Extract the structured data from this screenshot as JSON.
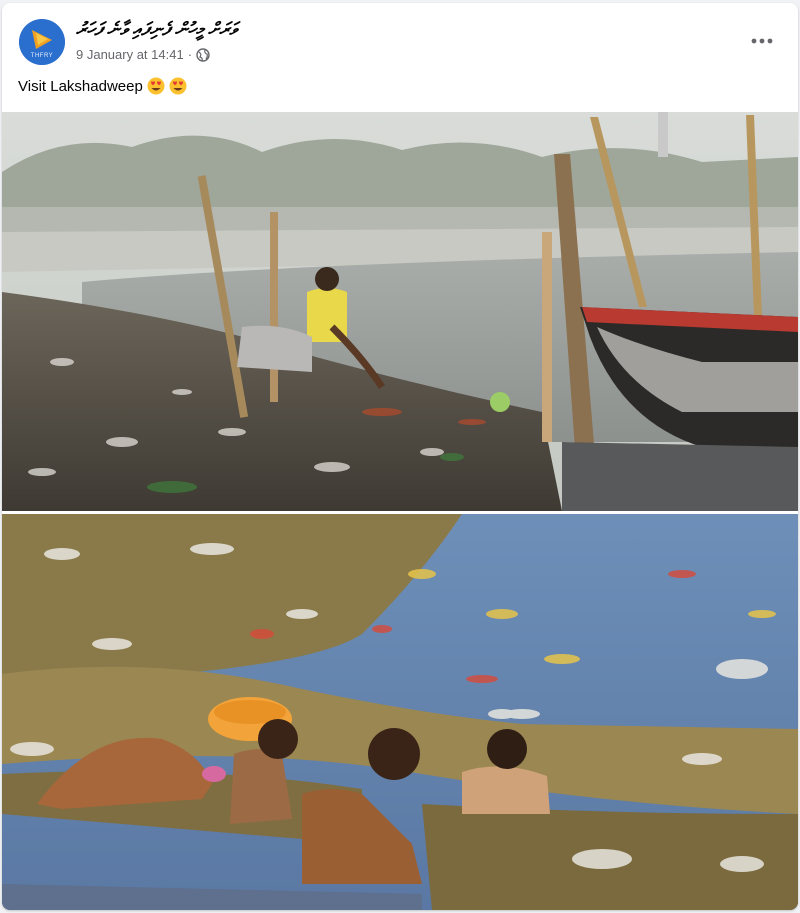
{
  "post": {
    "page_name": "ވަރަށް މީހުން ފެނިފައި ވާނެ ފަހަރު",
    "avatar_text": "THFRY",
    "timestamp": "9 January at 14:41",
    "separator": "·",
    "privacy_icon": "globe-icon",
    "more_icon": "more-options-icon",
    "text": "Visit Lakshadweep",
    "emojis": [
      "heart-eyes-emoji",
      "heart-eyes-emoji"
    ]
  },
  "photos": [
    {
      "subject": "polluted riverbank with man in yellow shirt and wooden boat"
    },
    {
      "subject": "people bathing in river filled with floating garbage and flowers"
    }
  ],
  "colors": {
    "background": "#f0f2f5",
    "card": "#ffffff",
    "secondary_text": "#65676b",
    "avatar_bg": "#2b6fce"
  }
}
